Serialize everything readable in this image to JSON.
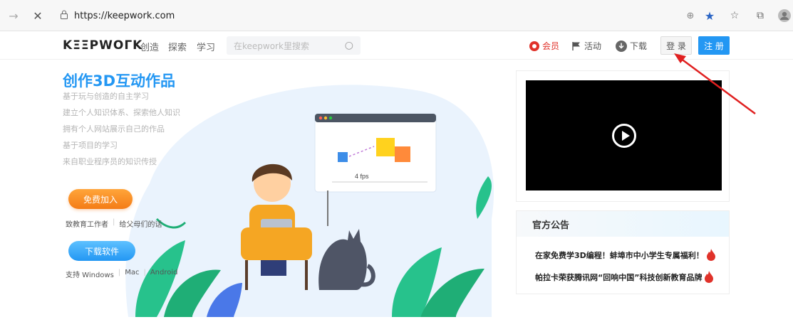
{
  "browser": {
    "url": "https://keepwork.com",
    "icons": [
      "back-arrow-icon",
      "close-icon",
      "lock-icon",
      "zoom-icon",
      "star-icon",
      "favorites-icon",
      "collections-icon",
      "profile-icon"
    ]
  },
  "header": {
    "logo": "KΞΞPWOΓK",
    "nav": [
      "创造",
      "探索",
      "学习"
    ],
    "search_placeholder": "在keepwork里搜索",
    "vip": "会员",
    "activity": "活动",
    "download": "下载",
    "login": "登 录",
    "register": "注 册"
  },
  "hero": {
    "title": "创作3D互动作品",
    "features": [
      "基于玩与创造的自主学习",
      "建立个人知识体系、探索他人知识",
      "拥有个人网站展示自己的作品",
      "基于项目的学习",
      "来自职业程序员的知识传授"
    ],
    "join": "免费加入",
    "audience_links": [
      "致教育工作者",
      "给父母们的话"
    ],
    "download_software": "下载软件",
    "platform_links": [
      "支持 Windows",
      "Mac",
      "Android"
    ],
    "fps_label": "4 fps"
  },
  "notice": {
    "title": "官方公告",
    "items": [
      "在家免费学3D编程！蚌埠市中小学生专属福利！",
      "帕拉卡荣获腾讯网“回响中国”科技创新教育品牌"
    ]
  },
  "colors": {
    "brand_blue": "#2397f3",
    "orange": "#f47c16",
    "annotation_red": "#e02020"
  }
}
